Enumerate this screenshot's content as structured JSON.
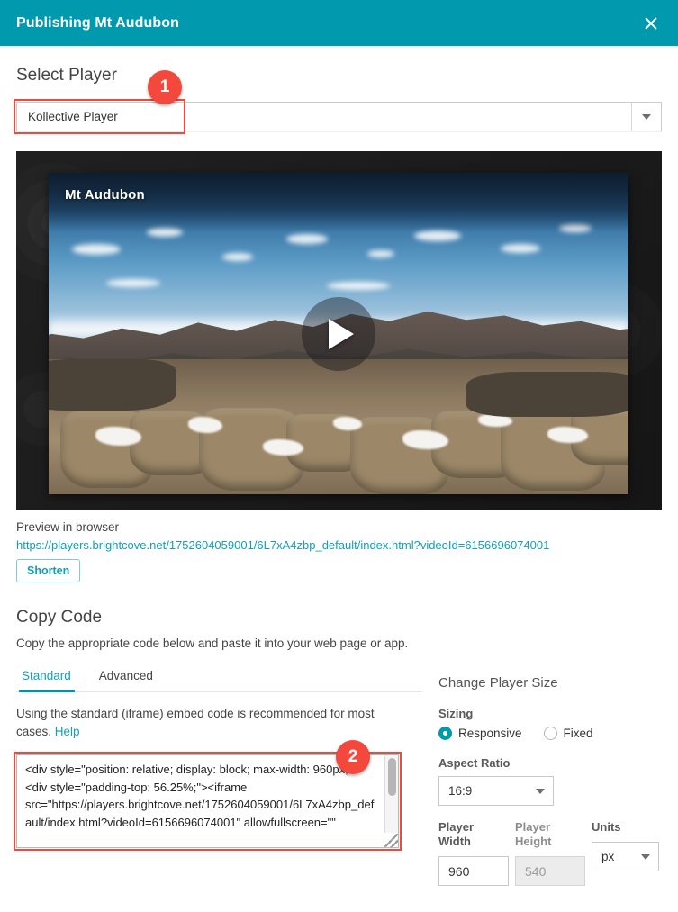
{
  "titlebar": {
    "title": "Publishing Mt Audubon",
    "close_icon": "close-icon"
  },
  "select_player": {
    "heading": "Select Player",
    "selected": "Kollective Player",
    "caret_icon": "chevron-down-icon"
  },
  "badges": [
    {
      "number": "1"
    },
    {
      "number": "2"
    }
  ],
  "video": {
    "title": "Mt Audubon",
    "play_icon": "play-icon"
  },
  "preview": {
    "label": "Preview in browser",
    "url": "https://players.brightcove.net/1752604059001/6L7xA4zbp_default/index.html?videoId=6156696074001",
    "shorten_label": "Shorten"
  },
  "copy_code": {
    "heading": "Copy Code",
    "subtitle": "Copy the appropriate code below and paste it into your web page or app.",
    "tabs": [
      {
        "label": "Standard",
        "active": true
      },
      {
        "label": "Advanced",
        "active": false
      }
    ],
    "description": "Using the standard (iframe) embed code is recommended for most cases. ",
    "help_link": "Help",
    "code": "<div style=\"position: relative; display: block; max-width: 960px;\"><div style=\"padding-top: 56.25%;\"><iframe src=\"https://players.brightcove.net/1752604059001/6L7xA4zbp_default/index.html?videoId=6156696074001\" allowfullscreen=\"\""
  },
  "player_size": {
    "heading": "Change Player Size",
    "sizing_label": "Sizing",
    "sizing_options": [
      {
        "label": "Responsive",
        "selected": true
      },
      {
        "label": "Fixed",
        "selected": false
      }
    ],
    "aspect_ratio_label": "Aspect Ratio",
    "aspect_ratio_value": "16:9",
    "width_label": "Player Width",
    "width_value": "960",
    "height_label": "Player Height",
    "height_value": "540",
    "units_label": "Units",
    "units_value": "px"
  },
  "colors": {
    "brand_teal": "#0099ad",
    "link_teal": "#0f9fbd",
    "badge_red": "#f4483c",
    "highlight_red": "#f4483c"
  }
}
